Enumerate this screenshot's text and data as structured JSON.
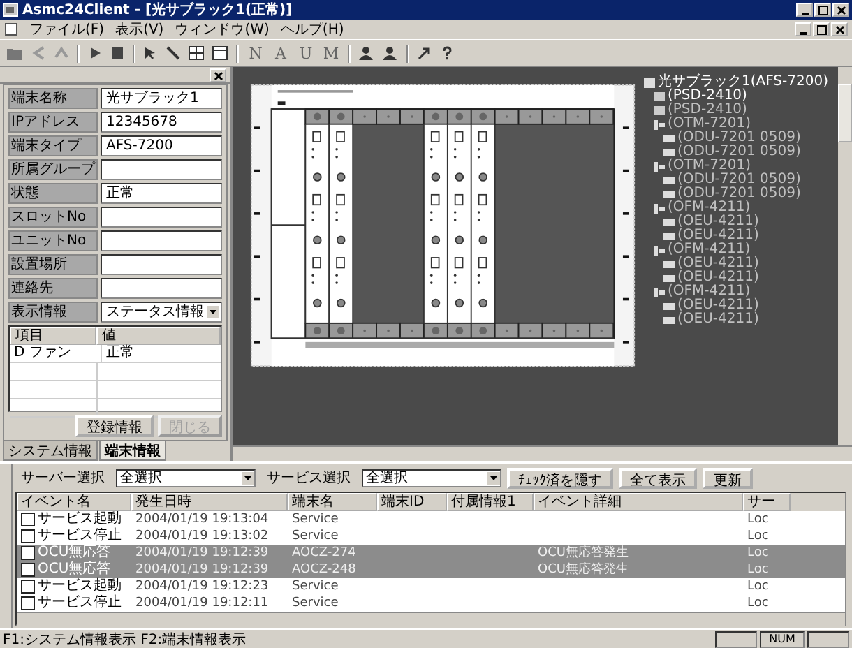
{
  "window": {
    "title": "Asmc24Client - [光サブラック1(正常)]"
  },
  "menu": [
    "ファイル(F)",
    "表示(V)",
    "ウィンドウ(W)",
    "ヘルプ(H)"
  ],
  "toolbar_letters": [
    "N",
    "A",
    "U",
    "M"
  ],
  "terminal_fields": [
    {
      "label": "端末名称",
      "value": "光サブラック1"
    },
    {
      "label": "IPアドレス",
      "value": "12345678"
    },
    {
      "label": "端末タイプ",
      "value": "AFS-7200"
    },
    {
      "label": "所属グループ"
    },
    {
      "label": "状態",
      "value": "正常"
    },
    {
      "label": "スロットNo"
    },
    {
      "label": "ユニットNo"
    },
    {
      "label": "設置場所"
    },
    {
      "label": "連絡先"
    }
  ],
  "display_select": {
    "label": "表示情報",
    "value": "ステータス情報"
  },
  "info_table": {
    "columns": [
      "項目",
      "値"
    ],
    "rows": [
      {
        "item": "D ファン",
        "value": "正常"
      }
    ]
  },
  "panel_buttons": [
    {
      "label": "登録情報",
      "disabled": false
    },
    {
      "label": "閉じる",
      "disabled": true
    }
  ],
  "panel_tabs": [
    {
      "label": "システム情報",
      "selected": false
    },
    {
      "label": "端末情報",
      "selected": true
    }
  ],
  "tree": [
    {
      "label": "光サブラック1(AFS-7200)",
      "dim": false,
      "expanded": true,
      "children": [
        {
          "label": "(PSD-2410)",
          "dim": false
        },
        {
          "label": "(PSD-2410)",
          "dim": true
        },
        {
          "label": "(OTM-7201)",
          "dim": true,
          "expanded": true,
          "children": [
            {
              "label": "(ODU-7201 0509)",
              "dim": true
            },
            {
              "label": "(ODU-7201 0509)",
              "dim": true
            }
          ]
        },
        {
          "label": "(OTM-7201)",
          "dim": true,
          "expanded": true,
          "children": [
            {
              "label": "(ODU-7201 0509)",
              "dim": true
            },
            {
              "label": "(ODU-7201 0509)",
              "dim": true
            }
          ]
        },
        {
          "label": "(OFM-4211)",
          "dim": true,
          "expanded": true,
          "children": [
            {
              "label": "(OEU-4211)",
              "dim": true
            },
            {
              "label": "(OEU-4211)",
              "dim": true
            }
          ]
        },
        {
          "label": "(OFM-4211)",
          "dim": true,
          "expanded": true,
          "children": [
            {
              "label": "(OEU-4211)",
              "dim": true
            },
            {
              "label": "(OEU-4211)",
              "dim": true
            }
          ]
        },
        {
          "label": "(OFM-4211)",
          "dim": true,
          "expanded": true,
          "children": [
            {
              "label": "(OEU-4211)",
              "dim": true
            },
            {
              "label": "(OEU-4211)",
              "dim": true
            }
          ]
        }
      ]
    }
  ],
  "filters": [
    {
      "label": "サーバー選択",
      "value": "全選択"
    },
    {
      "label": "サービス選択",
      "value": "全選択"
    }
  ],
  "event_buttons": [
    "ﾁｪｯｸ済を隠す",
    "全て表示",
    "更新"
  ],
  "events": {
    "columns": [
      "イベント名",
      "発生日時",
      "端末名",
      "端末ID",
      "付属情報1",
      "イベント詳細",
      "サー"
    ],
    "rows": [
      {
        "kind": "normal",
        "checked": false,
        "name": "サービス起動",
        "time": "2004/01/19 19:13:04",
        "terminal": "Service",
        "server": "Loc"
      },
      {
        "kind": "normal",
        "checked": false,
        "name": "サービス停止",
        "time": "2004/01/19 19:13:02",
        "terminal": "Service",
        "server": "Loc"
      },
      {
        "kind": "alarm",
        "checked": false,
        "name": "OCU無応答",
        "time": "2004/01/19 19:12:39",
        "terminal": "AOCZ-274",
        "detail": "OCU無応答発生",
        "server": "Loc"
      },
      {
        "kind": "alarm",
        "checked": false,
        "name": "OCU無応答",
        "time": "2004/01/19 19:12:39",
        "terminal": "AOCZ-248",
        "detail": "OCU無応答発生",
        "server": "Loc"
      },
      {
        "kind": "normal",
        "checked": false,
        "name": "サービス起動",
        "time": "2004/01/19 19:12:23",
        "terminal": "Service",
        "server": "Loc"
      },
      {
        "kind": "normal",
        "checked": false,
        "name": "サービス停止",
        "time": "2004/01/19 19:12:11",
        "terminal": "Service",
        "server": "Loc"
      }
    ]
  },
  "status_bar": {
    "text": "F1:システム情報表示 F2:端末情報表示",
    "indicator": "NUM"
  }
}
